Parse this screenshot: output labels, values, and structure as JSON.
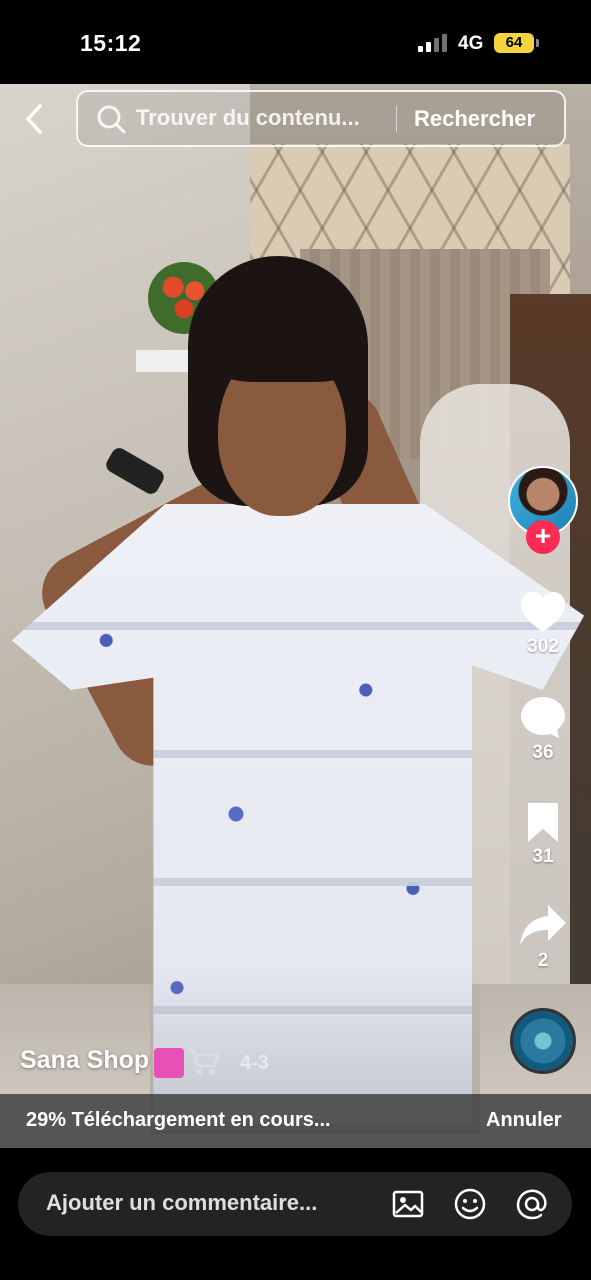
{
  "status_bar": {
    "time": "15:12",
    "network": "4G",
    "battery": "64"
  },
  "search": {
    "placeholder": "Trouver du contenu...",
    "submit_label": "Rechercher"
  },
  "actions": {
    "likes": "302",
    "comments": "36",
    "saves": "31",
    "shares": "2"
  },
  "video": {
    "username": "Sana Shop",
    "overlay_text": "4-3"
  },
  "download": {
    "status": "29% Téléchargement en cours...",
    "cancel_label": "Annuler"
  },
  "comment": {
    "placeholder": "Ajouter un commentaire..."
  },
  "colors": {
    "follow": "#fe2c55",
    "battery": "#f5d43d",
    "comment_bg": "#232323"
  },
  "icons": [
    "back-icon",
    "search-icon",
    "plus-icon",
    "heart-icon",
    "comment-icon",
    "bookmark-icon",
    "share-icon",
    "music-disc-icon",
    "shopping-bag-icon",
    "cart-icon",
    "image-icon",
    "emoji-icon",
    "mention-icon"
  ]
}
